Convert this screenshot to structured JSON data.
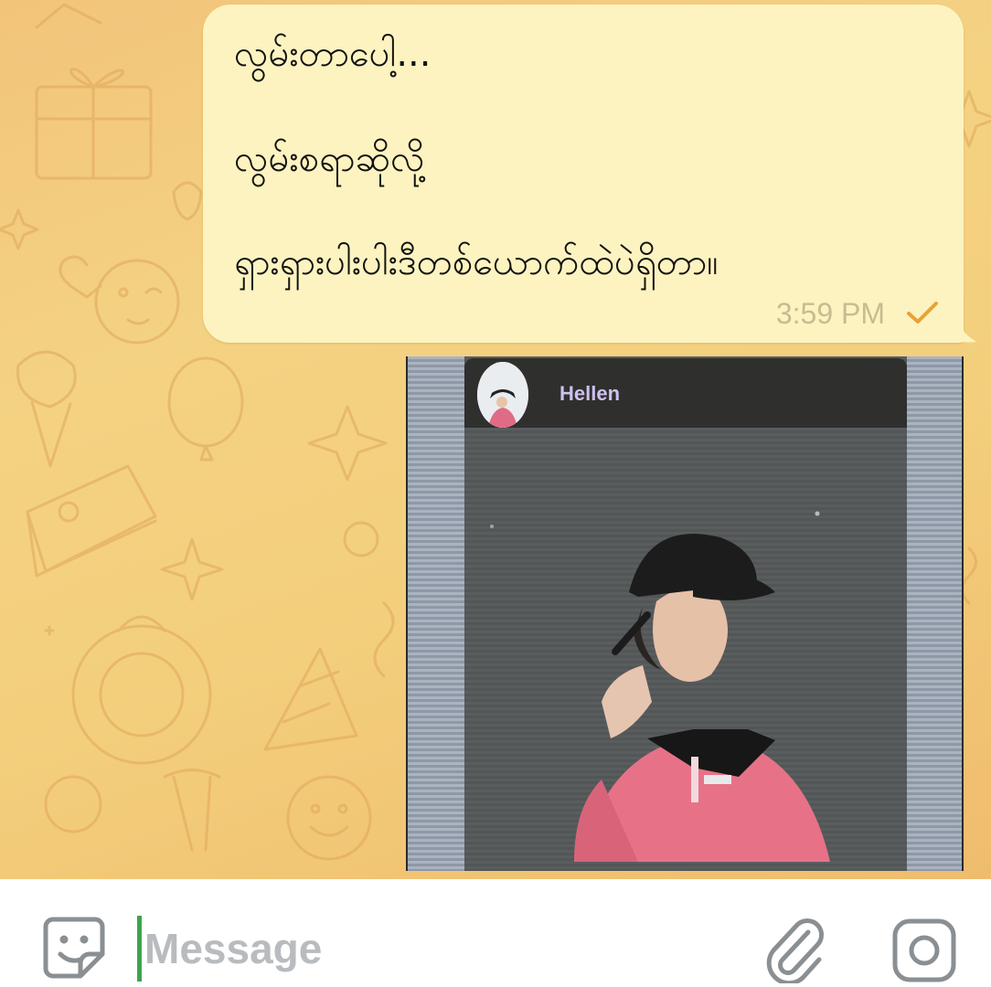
{
  "chat": {
    "message": {
      "lines": [
        "လွမ်းတာပေါ့...",
        "လွမ်းစရာဆိုလို့",
        "ရှားရှားပါးပါးဒီတစ်ယောက်ထဲပဲရှိတာ။"
      ],
      "time": "3:59 PM",
      "status_icon": "single-check-icon"
    },
    "photo": {
      "profile_name": "Hellen"
    }
  },
  "composer": {
    "placeholder": "Message",
    "icons": [
      "sticker-icon",
      "attach-icon",
      "camera-icon"
    ]
  },
  "colors": {
    "bubble": "#fdf3c0",
    "check": "#e8a23a",
    "caret": "#3fa34d"
  }
}
